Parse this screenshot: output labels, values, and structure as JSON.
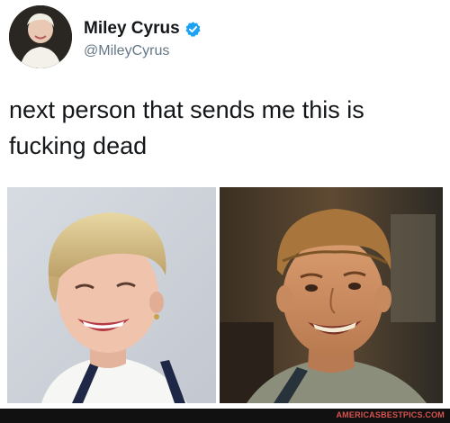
{
  "tweet": {
    "display_name": "Miley Cyrus",
    "handle": "@MileyCyrus",
    "verified": true,
    "text": "next person that sends me this is\nfucking dead"
  },
  "images": {
    "left": "woman-smiling-photo",
    "right": "man-smiling-photo"
  },
  "icons": {
    "verified": "verified-badge-icon",
    "avatar": "profile-avatar"
  },
  "footer": {
    "watermark": "AMERICASBESTPICS.COM"
  },
  "colors": {
    "verified_blue": "#1da1f2",
    "watermark_red": "#d9534f",
    "footer_bg": "#111111"
  }
}
